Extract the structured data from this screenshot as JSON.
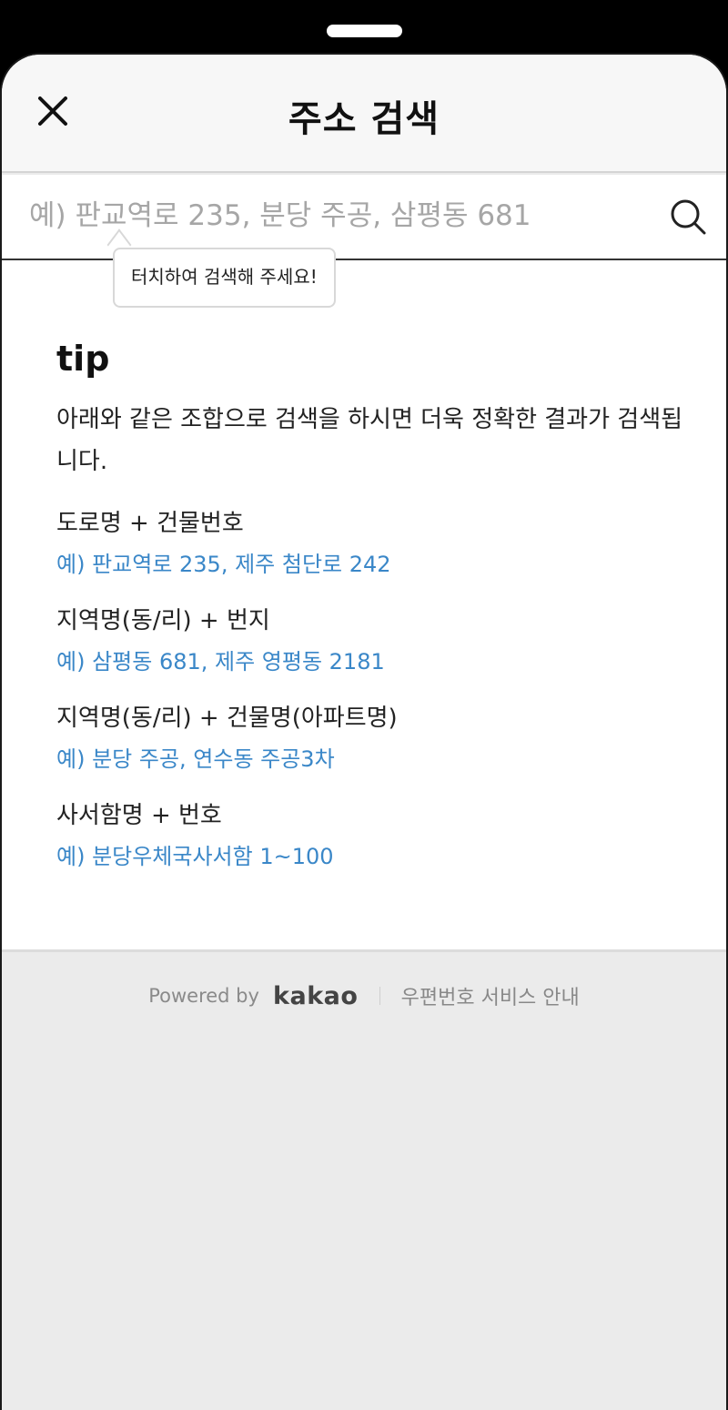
{
  "header": {
    "title": "주소 검색"
  },
  "search": {
    "placeholder": "예) 판교역로 235, 분당 주공, 삼평동 681",
    "value": ""
  },
  "tooltip": {
    "text": "터치하여 검색해 주세요!"
  },
  "tip": {
    "title": "tip",
    "description": "아래와 같은 조합으로 검색을 하시면 더욱 정확한 결과가 검색됩니다.",
    "items": [
      {
        "label": "도로명 + 건물번호",
        "example": "예) 판교역로 235,  제주 첨단로 242"
      },
      {
        "label": "지역명(동/리) + 번지",
        "example": "예) 삼평동 681,  제주 영평동 2181"
      },
      {
        "label": "지역명(동/리) + 건물명(아파트명)",
        "example": "예) 분당 주공,  연수동 주공3차"
      },
      {
        "label": "사서함명 + 번호",
        "example": "예) 분당우체국사서함 1~100"
      }
    ]
  },
  "footer": {
    "powered_by": "Powered by",
    "brand": "kakao",
    "service_link": "우편번호 서비스 안내"
  },
  "icons": {
    "close": "close-icon",
    "search": "search-icon"
  },
  "colors": {
    "example_text": "#3a87c8",
    "background": "#ebebeb"
  }
}
